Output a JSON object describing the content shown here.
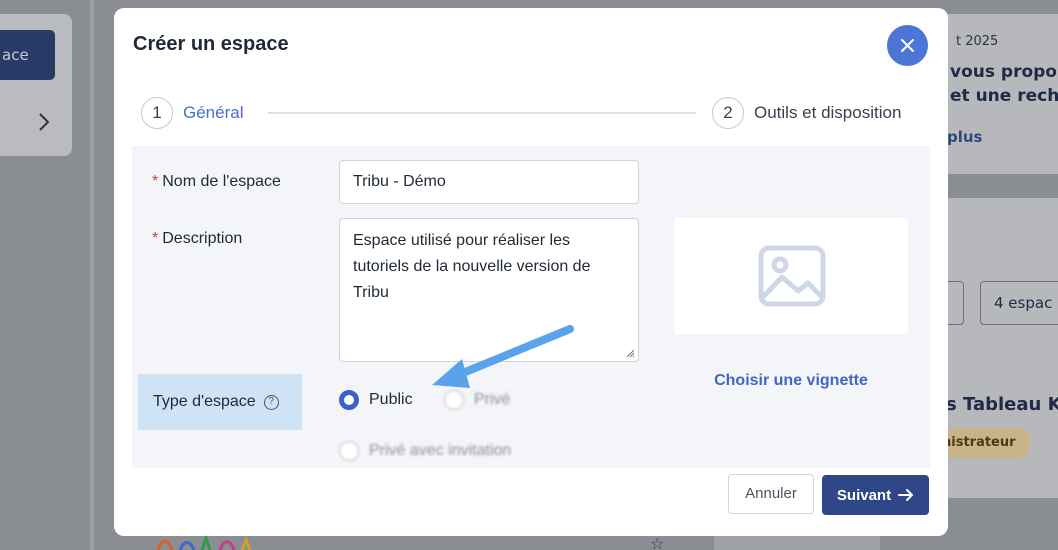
{
  "background": {
    "left_button_label": "ace",
    "date_text": "t 2025",
    "headline_line1": "vous propo",
    "headline_line2": "et une reche",
    "more_link": "plus",
    "count_box": "4 espac",
    "card_title": "s Tableau Ko",
    "role_badge": "nistrateur"
  },
  "modal": {
    "title": "Créer un espace",
    "close_icon": "close-icon",
    "steps": [
      {
        "number": "1",
        "label": "Général"
      },
      {
        "number": "2",
        "label": "Outils et disposition"
      }
    ],
    "form": {
      "name_label": "Nom de l'espace",
      "name_value": "Tribu - Démo",
      "description_label": "Description",
      "description_value": "Espace utilisé pour réaliser les tutoriels de la nouvelle version de Tribu",
      "type_label": "Type d'espace",
      "type_options": [
        {
          "label": "Public",
          "selected": true
        },
        {
          "label": "Privé",
          "selected": false
        },
        {
          "label": "Privé avec invitation",
          "selected": false
        }
      ],
      "required_marker": "*"
    },
    "thumbnail": {
      "icon": "image-placeholder-icon",
      "choose_label": "Choisir une vignette"
    },
    "buttons": {
      "cancel_label": "Annuler",
      "next_label": "Suivant"
    }
  },
  "colors": {
    "primary": "#2f4687",
    "accent": "#4b76d6",
    "highlight": "#cfe3f7",
    "required": "#d23a3a",
    "annotation_arrow": "#5aa3ec"
  }
}
